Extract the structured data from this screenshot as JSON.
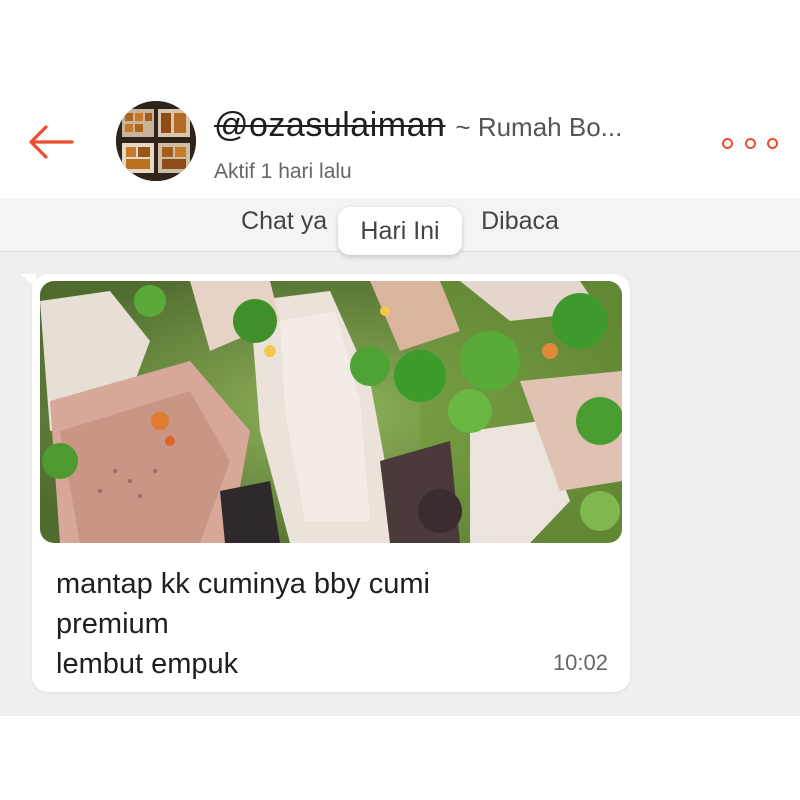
{
  "header": {
    "username": "@ozasulaiman",
    "shop_name": "~ Rumah Bo...",
    "status": "Aktif 1 hari lalu",
    "back_icon": "arrow-left-icon",
    "more_icon": "more-dots-icon",
    "accent_color": "#ee4d2d"
  },
  "banner": {
    "text_left": "Chat ya",
    "text_right": "Dibaca"
  },
  "date_chip": "Hari Ini",
  "message": {
    "lines": [
      "mantap kk cuminya bby cumi",
      "premium",
      "lembut empuk"
    ],
    "time": "10:02",
    "image_description_icon": "food-photo"
  }
}
